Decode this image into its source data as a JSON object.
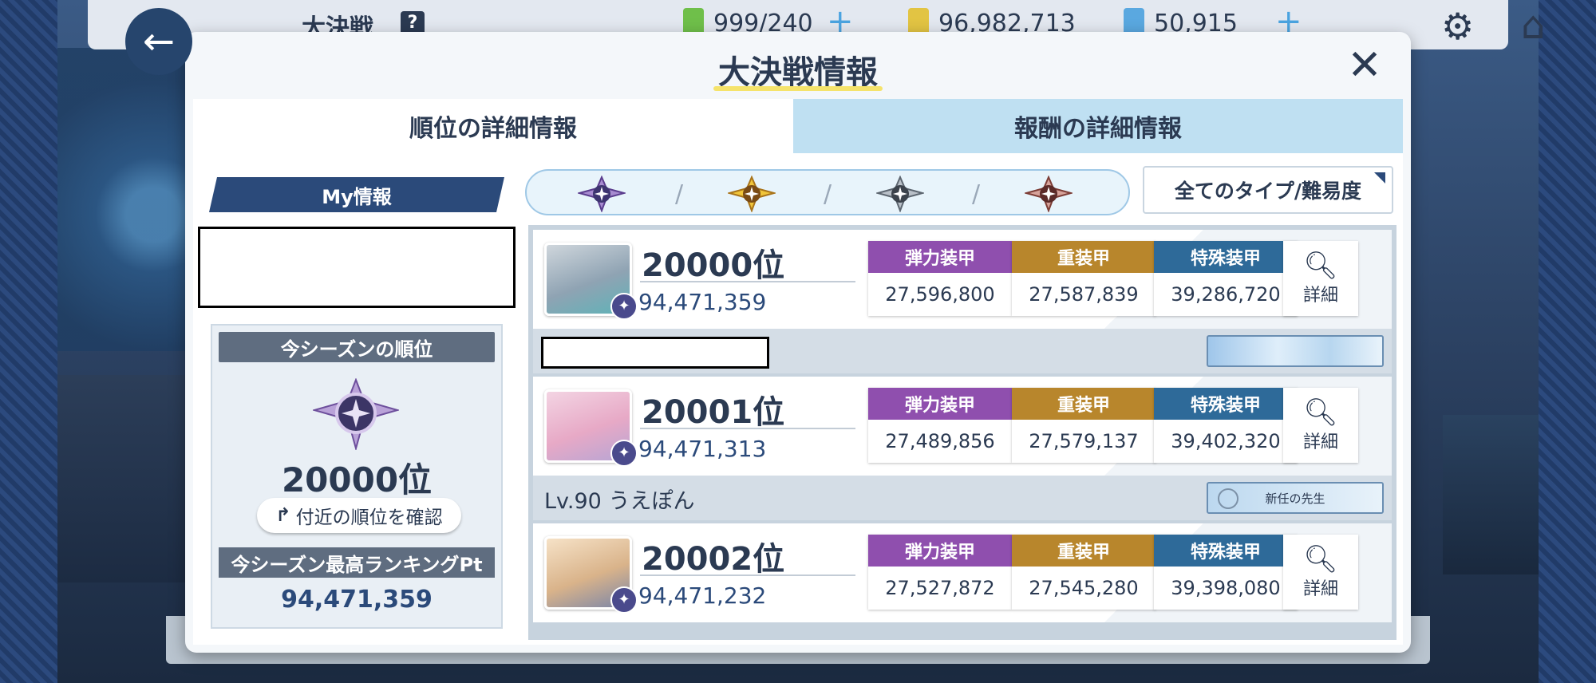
{
  "topbar": {
    "title": "大決戦",
    "help_icon": "?",
    "ap": "999/240",
    "credits": "96,982,713",
    "gems": "50,915"
  },
  "modal": {
    "title": "大決戦情報",
    "close_icon": "✕",
    "tabs": [
      {
        "label": "順位の詳細情報",
        "active": true
      },
      {
        "label": "報酬の詳細情報",
        "active": false
      }
    ]
  },
  "my_info": {
    "header": "My情報",
    "season_rank_label": "今シーズンの順位",
    "season_rank": "20000位",
    "nearby_button": "付近の順位を確認",
    "best_pt_label": "今シーズン最高ランキングPt",
    "best_pt": "94,471,359"
  },
  "filter": {
    "difficulty_icons": [
      "difficulty-purple-icon",
      "difficulty-gold-icon",
      "difficulty-gray-icon",
      "difficulty-copper-icon"
    ],
    "type_dropdown": "全てのタイプ/難易度"
  },
  "armor_labels": {
    "light": "弾力装甲",
    "heavy": "重装甲",
    "special": "特殊装甲"
  },
  "colors": {
    "light": "#8f4fae",
    "heavy": "#b8862c",
    "special": "#2e6a99"
  },
  "detail_label": "詳細",
  "entries": [
    {
      "rank": "20000位",
      "score": "94,471,359",
      "light": "27,596,800",
      "heavy": "27,587,839",
      "special": "39,286,720",
      "name": "",
      "title_card": ""
    },
    {
      "rank": "20001位",
      "score": "94,471,313",
      "light": "27,489,856",
      "heavy": "27,579,137",
      "special": "39,402,320",
      "name": "Lv.90 うえぽん",
      "title_card": "新任の先生"
    },
    {
      "rank": "20002位",
      "score": "94,471,232",
      "light": "27,527,872",
      "heavy": "27,545,280",
      "special": "39,398,080",
      "name": "",
      "title_card": ""
    }
  ]
}
